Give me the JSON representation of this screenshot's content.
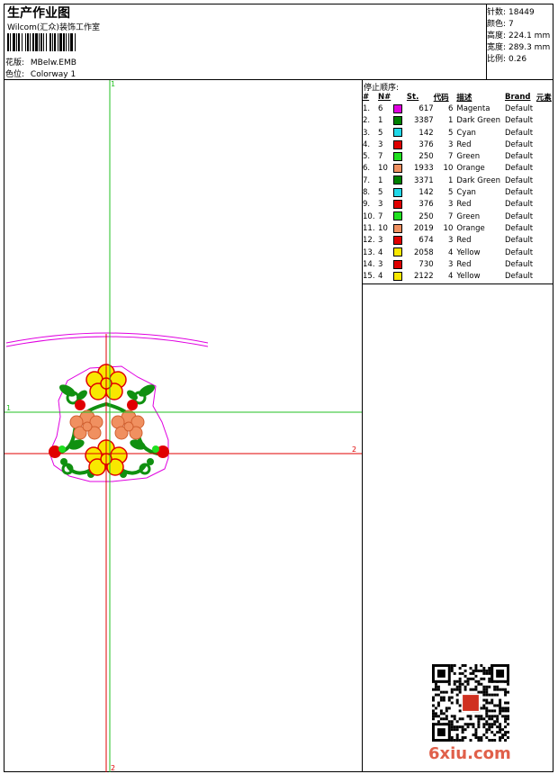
{
  "header": {
    "title": "生产作业图",
    "subtitle": "Wilcom(汇众)装饰工作室",
    "design_label": "花版:",
    "design_value": "MBelw.EMB",
    "colorway_label": "色位:",
    "colorway_value": "Colorway 1"
  },
  "stats": [
    {
      "label": "针数:",
      "value": "18449"
    },
    {
      "label": "颜色:",
      "value": "7"
    },
    {
      "label": "高度:",
      "value": "224.1 mm"
    },
    {
      "label": "宽度:",
      "value": "289.3 mm"
    },
    {
      "label": "比例:",
      "value": "0.26"
    }
  ],
  "stop_sequence": {
    "title": "停止顺序:",
    "headers": [
      "#",
      "N#",
      "St.",
      "代码",
      "描述",
      "Brand",
      "元素"
    ],
    "rows": [
      {
        "idx": "1.",
        "n": "6",
        "color": "#e000e0",
        "st": "617",
        "code": "6",
        "desc": "Magenta",
        "brand": "Default"
      },
      {
        "idx": "2.",
        "n": "1",
        "color": "#008000",
        "st": "3387",
        "code": "1",
        "desc": "Dark Green",
        "brand": "Default"
      },
      {
        "idx": "3.",
        "n": "5",
        "color": "#20d8e8",
        "st": "142",
        "code": "5",
        "desc": "Cyan",
        "brand": "Default"
      },
      {
        "idx": "4.",
        "n": "3",
        "color": "#e00000",
        "st": "376",
        "code": "3",
        "desc": "Red",
        "brand": "Default"
      },
      {
        "idx": "5.",
        "n": "7",
        "color": "#20e020",
        "st": "250",
        "code": "7",
        "desc": "Green",
        "brand": "Default"
      },
      {
        "idx": "6.",
        "n": "10",
        "color": "#f09060",
        "st": "1933",
        "code": "10",
        "desc": "Orange",
        "brand": "Default"
      },
      {
        "idx": "7.",
        "n": "1",
        "color": "#008000",
        "st": "3371",
        "code": "1",
        "desc": "Dark Green",
        "brand": "Default"
      },
      {
        "idx": "8.",
        "n": "5",
        "color": "#20d8e8",
        "st": "142",
        "code": "5",
        "desc": "Cyan",
        "brand": "Default"
      },
      {
        "idx": "9.",
        "n": "3",
        "color": "#e00000",
        "st": "376",
        "code": "3",
        "desc": "Red",
        "brand": "Default"
      },
      {
        "idx": "10.",
        "n": "7",
        "color": "#20e020",
        "st": "250",
        "code": "7",
        "desc": "Green",
        "brand": "Default"
      },
      {
        "idx": "11.",
        "n": "10",
        "color": "#f09060",
        "st": "2019",
        "code": "10",
        "desc": "Orange",
        "brand": "Default"
      },
      {
        "idx": "12.",
        "n": "3",
        "color": "#e00000",
        "st": "674",
        "code": "3",
        "desc": "Red",
        "brand": "Default"
      },
      {
        "idx": "13.",
        "n": "4",
        "color": "#f8e800",
        "st": "2058",
        "code": "4",
        "desc": "Yellow",
        "brand": "Default"
      },
      {
        "idx": "14.",
        "n": "3",
        "color": "#e00000",
        "st": "730",
        "code": "3",
        "desc": "Red",
        "brand": "Default"
      },
      {
        "idx": "15.",
        "n": "4",
        "color": "#f8e800",
        "st": "2122",
        "code": "4",
        "desc": "Yellow",
        "brand": "Default"
      }
    ]
  },
  "axis_labels": {
    "v_top": "1",
    "v_bottom": "2",
    "h_left": "1",
    "h_right": "2"
  },
  "watermark": "6xiu.com",
  "colors": {
    "green_axis": "#20c020",
    "red_axis": "#e00000",
    "magenta": "#e000e0"
  }
}
